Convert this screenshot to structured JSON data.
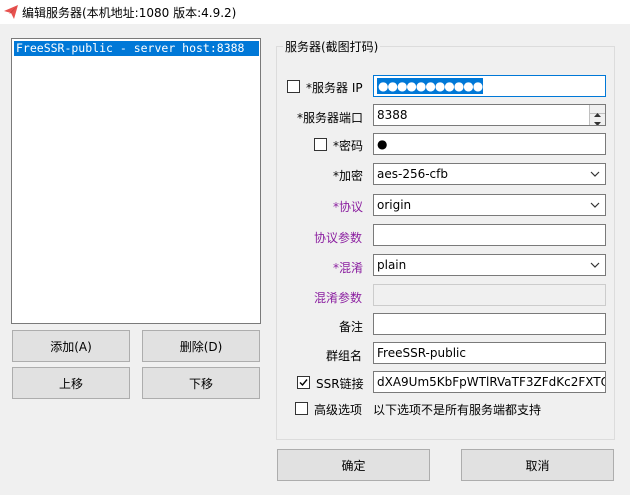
{
  "window": {
    "title": "编辑服务器(本机地址:1080 版本:4.9.2)"
  },
  "server_list": {
    "items": [
      "FreeSSR-public - server host:8388"
    ]
  },
  "buttons": {
    "add": "添加(A)",
    "delete": "删除(D)",
    "move_up": "上移",
    "move_down": "下移",
    "ok": "确定",
    "cancel": "取消"
  },
  "group": {
    "title": "服务器(截图打码)"
  },
  "form": {
    "server_ip_label": "*服务器 IP",
    "server_ip_value": "●●●●●●●●●●●",
    "server_port_label": "*服务器端口",
    "server_port_value": "8388",
    "password_label": "*密码",
    "password_value": "●",
    "encryption_label": "*加密",
    "encryption_value": "aes-256-cfb",
    "protocol_label": "*协议",
    "protocol_value": "origin",
    "protocol_param_label": "协议参数",
    "protocol_param_value": "",
    "obfs_label": "*混淆",
    "obfs_value": "plain",
    "obfs_param_label": "混淆参数",
    "obfs_param_value": "",
    "remarks_label": "备注",
    "remarks_value": "",
    "group_name_label": "群组名",
    "group_name_value": "FreeSSR-public",
    "ssr_link_label": "SSR链接",
    "ssr_link_value": "dXA9Um5KbFpWTlRVaTF3ZFdKc2FXTQ",
    "advanced_label": "高级选项",
    "advanced_note": "以下选项不是所有服务端都支持"
  },
  "checkboxes": {
    "show_ip": false,
    "show_password": false,
    "ssr_link": true,
    "advanced": false
  },
  "colors": {
    "selection": "#0078d7",
    "purple_label": "#8b1fa0"
  }
}
